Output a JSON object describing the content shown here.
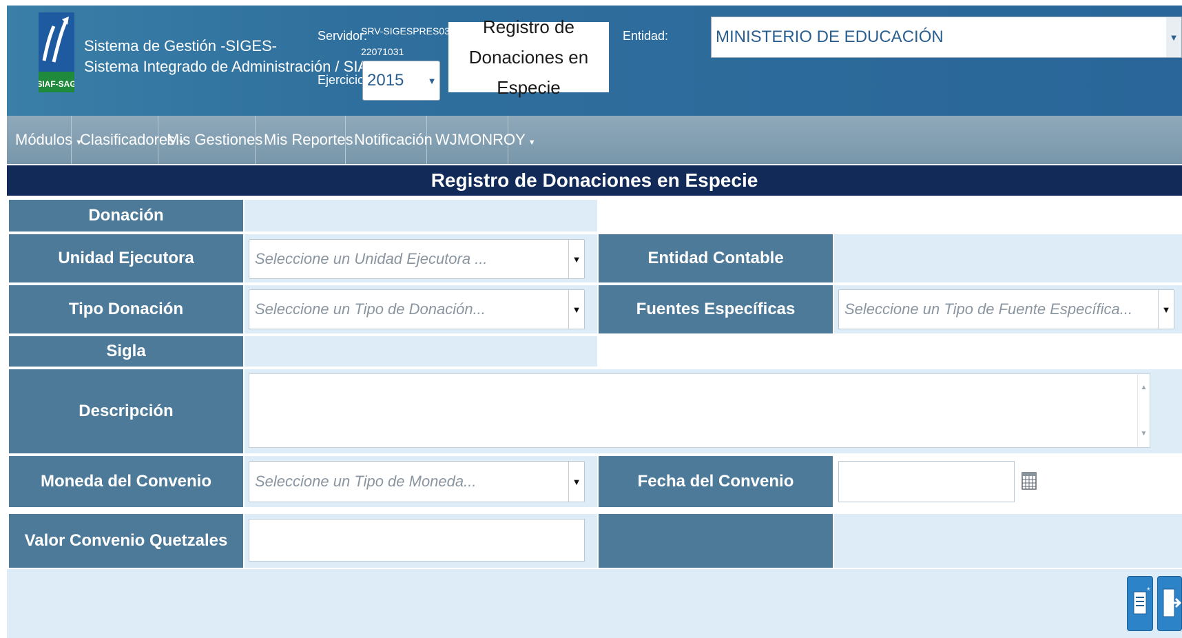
{
  "header": {
    "logo_text": "SIAF-SAG",
    "system_line1": "Sistema de Gestión -SIGES-",
    "system_line2": "Sistema Integrado de Administración / SIAF",
    "server_label": "Servidor:",
    "server_name": "SRV-SIGESPRES03",
    "server_code": "22071031",
    "year_label": "Ejercicio:",
    "year_value": "2015",
    "module_title": "Registro de Donaciones en Especie",
    "entity_label": "Entidad:",
    "entity_value": "MINISTERIO DE EDUCACIÓN"
  },
  "nav": {
    "items": [
      {
        "label": "Módulos",
        "has_menu": true
      },
      {
        "label": "Clasificadores",
        "has_menu": true
      },
      {
        "label": "Mis Gestiones",
        "has_menu": false
      },
      {
        "label": "Mis Reportes",
        "has_menu": false
      },
      {
        "label": "Notificación",
        "has_menu": false
      },
      {
        "label": "WJMONROY",
        "has_menu": true
      }
    ]
  },
  "form": {
    "title": "Registro de Donaciones en Especie",
    "donacion_label": "Donación",
    "unidad_label": "Unidad Ejecutora",
    "unidad_placeholder": "Seleccione un Unidad Ejecutora ...",
    "entidad_contable_label": "Entidad Contable",
    "tipo_label": "Tipo Donación",
    "tipo_placeholder": "Seleccione un Tipo de Donación...",
    "fuentes_label": "Fuentes Específicas",
    "fuentes_placeholder": "Seleccione un Tipo de Fuente Específica...",
    "sigla_label": "Sigla",
    "descripcion_label": "Descripción",
    "moneda_label": "Moneda del Convenio",
    "moneda_placeholder": "Seleccione un Tipo de Moneda...",
    "fecha_label": "Fecha del Convenio",
    "valor_label": "Valor Convenio Quetzales"
  },
  "colors": {
    "header_blue": "#2f6f9d",
    "nav_gray": "#7896aa",
    "title_bar": "#112a57",
    "label_bg": "#4e7a99",
    "field_bg": "#ddecf7"
  }
}
